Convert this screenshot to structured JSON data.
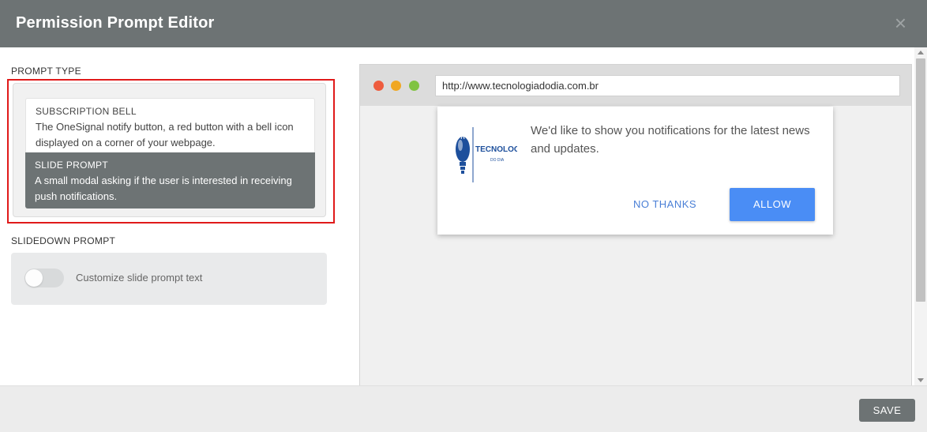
{
  "header": {
    "title": "Permission Prompt Editor",
    "close_glyph": "×"
  },
  "prompt_type": {
    "label": "PROMPT TYPE",
    "options": [
      {
        "title": "SUBSCRIPTION BELL",
        "description": "The OneSignal notify button, a red button with a bell icon displayed on a corner of your webpage.",
        "selected": false
      },
      {
        "title": "SLIDE PROMPT",
        "description": "A small modal asking if the user is interested in receiving push notifications.",
        "selected": true
      }
    ]
  },
  "slidedown": {
    "label": "SLIDEDOWN PROMPT",
    "toggle_label": "Customize slide prompt text",
    "toggle_on": false
  },
  "preview": {
    "url": "http://www.tecnologiadodia.com.br",
    "logo": {
      "name": "TECNOLOGIA",
      "sub": "DO DIA"
    },
    "message": "We'd like to show you notifications for the latest news and updates.",
    "cancel_label": "NO THANKS",
    "allow_label": "ALLOW"
  },
  "footer": {
    "save_label": "SAVE"
  },
  "colors": {
    "header_bg": "#6d7374",
    "highlight_border": "#e01a1a",
    "allow_button": "#4a8df5",
    "no_thanks_text": "#4a7fd6",
    "logo_blue": "#1d4f9c"
  }
}
